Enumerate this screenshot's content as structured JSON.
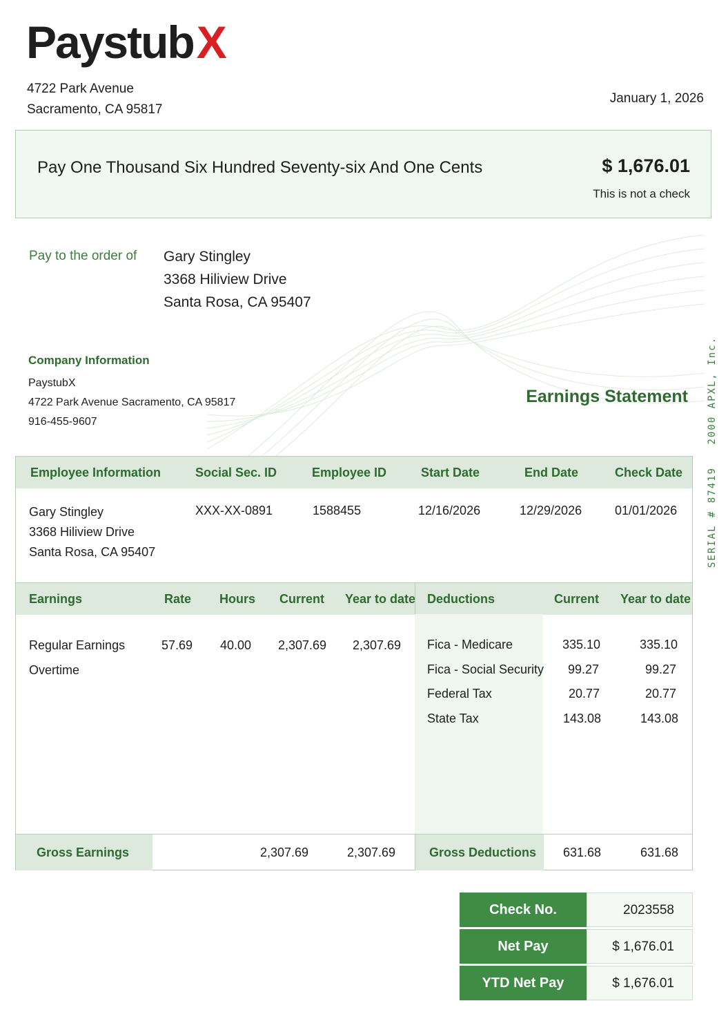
{
  "brand": {
    "name": "Paystub",
    "accent": "X",
    "accent_color": "#d81f26",
    "primary_color": "#3f8c45"
  },
  "company_address": {
    "line1": "4722 Park Avenue",
    "line2": "Sacramento, CA 95817"
  },
  "date": "January 1, 2026",
  "pay_box": {
    "amount_words": "Pay One Thousand Six Hundred Seventy-six And One Cents",
    "amount": "$ 1,676.01",
    "note": "This is not a check"
  },
  "pay_to": {
    "label": "Pay to the order of",
    "name": "Gary Stingley",
    "address1": "3368 Hiliview Drive",
    "address2": "Santa Rosa, CA 95407"
  },
  "company_info": {
    "title": "Company Information",
    "name": "PaystubX",
    "address": "4722 Park Avenue Sacramento, CA 95817",
    "phone": "916-455-9607"
  },
  "statement_title": "Earnings Statement",
  "side_text": {
    "copyright": "2000 APXL, Inc.",
    "serial": "SERIAL # 87419"
  },
  "employee_table": {
    "headers": [
      "Employee Information",
      "Social Sec. ID",
      "Employee ID",
      "Start Date",
      "End Date",
      "Check Date"
    ],
    "employee": {
      "name": "Gary Stingley",
      "address1": "3368 Hiliview Drive",
      "address2": "Santa Rosa, CA 95407",
      "ssn": "XXX-XX-0891",
      "employee_id": "1588455",
      "start_date": "12/16/2026",
      "end_date": "12/29/2026",
      "check_date": "01/01/2026"
    }
  },
  "earnings": {
    "headers": [
      "Earnings",
      "Rate",
      "Hours",
      "Current",
      "Year to date"
    ],
    "rows": [
      {
        "label": "Regular Earnings",
        "rate": "57.69",
        "hours": "40.00",
        "current": "2,307.69",
        "ytd": "2,307.69"
      },
      {
        "label": "Overtime",
        "rate": "",
        "hours": "",
        "current": "",
        "ytd": ""
      }
    ],
    "total_label": "Gross Earnings",
    "total_current": "2,307.69",
    "total_ytd": "2,307.69"
  },
  "deductions": {
    "headers": [
      "Deductions",
      "Current",
      "Year to date"
    ],
    "rows": [
      {
        "label": "Fica - Medicare",
        "current": "335.10",
        "ytd": "335.10"
      },
      {
        "label": "Fica - Social Security",
        "current": "99.27",
        "ytd": "99.27"
      },
      {
        "label": "Federal Tax",
        "current": "20.77",
        "ytd": "20.77"
      },
      {
        "label": "State Tax",
        "current": "143.08",
        "ytd": "143.08"
      }
    ],
    "total_label": "Gross Deductions",
    "total_current": "631.68",
    "total_ytd": "631.68"
  },
  "summary": [
    {
      "label": "Check No.",
      "value": "2023558"
    },
    {
      "label": "Net Pay",
      "value": "$ 1,676.01"
    },
    {
      "label": "YTD Net Pay",
      "value": "$ 1,676.01"
    }
  ]
}
